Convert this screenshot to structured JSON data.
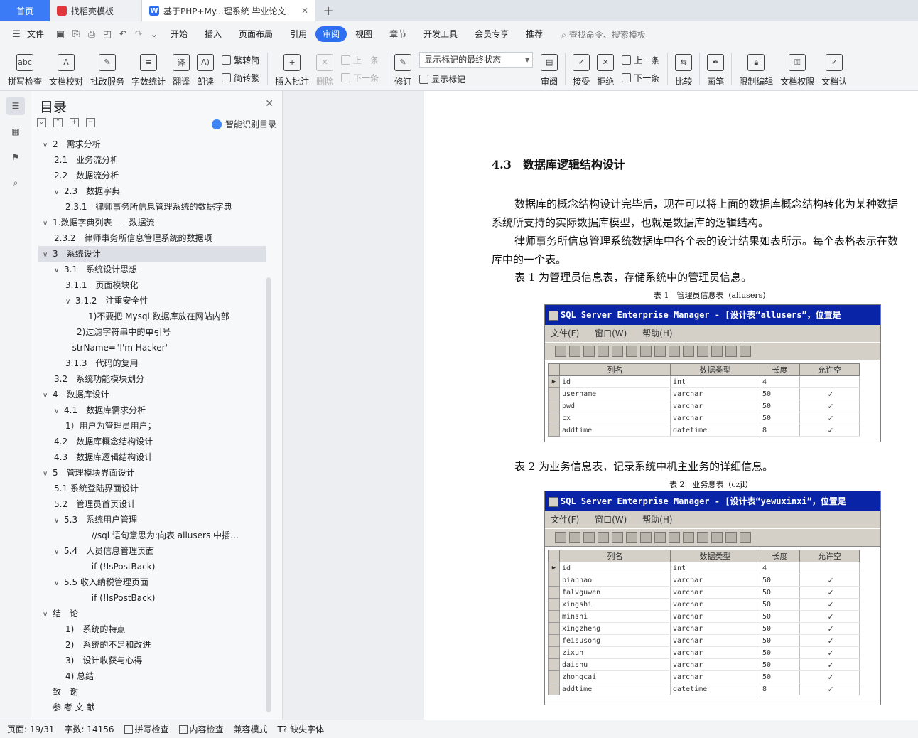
{
  "tabs": [
    {
      "label": "首页"
    },
    {
      "label": "找稻壳模板"
    },
    {
      "label": "基于PHP+My...理系统 毕业论文"
    }
  ],
  "menu": {
    "file": "文件",
    "items": [
      "开始",
      "插入",
      "页面布局",
      "引用",
      "审阅",
      "视图",
      "章节",
      "开发工具",
      "会员专享",
      "推荐"
    ],
    "active": "审阅",
    "search": "查找命令、搜索模板"
  },
  "ribbon": {
    "spell": "拼写检查",
    "proof": "文档校对",
    "batch": "批改服务",
    "count": "字数统计",
    "translate": "翻译",
    "read": "朗读",
    "to_trad": "繁转简",
    "to_simp": "简转繁",
    "insert_comment": "插入批注",
    "delete": "删除",
    "prev": "上一条",
    "next": "下一条",
    "revise": "修订",
    "markup_state": "显示标记的最终状态",
    "show_markup": "显示标记",
    "review": "审阅",
    "accept": "接受",
    "reject": "拒绝",
    "prev2": "上一条",
    "next2": "下一条",
    "compare": "比较",
    "pen": "画笔",
    "restrict": "限制编辑",
    "doc_perm": "文档权限",
    "doc_more": "文档认"
  },
  "toc": {
    "title": "目录",
    "smart": "智能识别目录",
    "items": [
      {
        "text": "2　需求分析",
        "level": 1,
        "caret": "v"
      },
      {
        "text": "2.1　业务流分析",
        "level": 2,
        "caret": ""
      },
      {
        "text": "2.2　数据流分析",
        "level": 2,
        "caret": ""
      },
      {
        "text": "2.3　数据字典",
        "level": 2,
        "caret": "v"
      },
      {
        "text": "2.3.1　律师事务所信息管理系统的数据字典",
        "level": 3,
        "caret": ""
      },
      {
        "text": "1.数据字典列表——数据流",
        "level": 1,
        "caret": "v"
      },
      {
        "text": "2.3.2　律师事务所信息管理系统的数据项",
        "level": 2,
        "caret": ""
      },
      {
        "text": "3　系统设计",
        "level": 1,
        "caret": "v",
        "selected": true
      },
      {
        "text": "3.1　系统设计思想",
        "level": 2,
        "caret": "v"
      },
      {
        "text": "3.1.1　页面模块化",
        "level": 3,
        "caret": ""
      },
      {
        "text": "3.1.2　注重安全性",
        "level": 3,
        "caret": "v"
      },
      {
        "text": "1)不要把 Mysql 数据库放在网站内部",
        "level": 5,
        "caret": ""
      },
      {
        "text": "2)过滤字符串中的单引号",
        "level": 4,
        "caret": ""
      },
      {
        "text": "strName=\"I'm Hacker\"",
        "level": 3.6,
        "caret": ""
      },
      {
        "text": "3.1.3　代码的复用",
        "level": 3,
        "caret": ""
      },
      {
        "text": "3.2　系统功能模块划分",
        "level": 2,
        "caret": ""
      },
      {
        "text": "4　数据库设计",
        "level": 1,
        "caret": "v"
      },
      {
        "text": "4.1　数据库需求分析",
        "level": 2,
        "caret": "v"
      },
      {
        "text": "1）用户为管理员用户；",
        "level": 3,
        "caret": ""
      },
      {
        "text": "4.2　数据库概念结构设计",
        "level": 2,
        "caret": ""
      },
      {
        "text": "4.3　数据库逻辑结构设计",
        "level": 2,
        "caret": ""
      },
      {
        "text": "5　管理模块界面设计",
        "level": 1,
        "caret": "v"
      },
      {
        "text": "5.1  系统登陆界面设计",
        "level": 2,
        "caret": ""
      },
      {
        "text": "5.2　管理员首页设计",
        "level": 2,
        "caret": ""
      },
      {
        "text": "5.3　系统用户管理",
        "level": 2,
        "caret": "v"
      },
      {
        "text": "//sql 语句意思为:向表 allusers 中插…",
        "level": 5.3,
        "caret": ""
      },
      {
        "text": "5.4　人员信息管理页面",
        "level": 2,
        "caret": "v"
      },
      {
        "text": "if (!IsPostBack)",
        "level": 5.3,
        "caret": ""
      },
      {
        "text": "5.5  收入纳税管理页面",
        "level": 2,
        "caret": "v"
      },
      {
        "text": "if (!IsPostBack)",
        "level": 5.3,
        "caret": ""
      },
      {
        "text": "结　论",
        "level": 1,
        "caret": "v"
      },
      {
        "text": "1)　系统的特点",
        "level": 3,
        "caret": ""
      },
      {
        "text": "2)　系统的不足和改进",
        "level": 3,
        "caret": ""
      },
      {
        "text": "3)　设计收获与心得",
        "level": 3,
        "caret": ""
      },
      {
        "text": "4) 总结",
        "level": 3,
        "caret": ""
      },
      {
        "text": "致　谢",
        "level": 1,
        "caret": "none"
      },
      {
        "text": "参 考 文 献",
        "level": 1,
        "caret": "none"
      }
    ]
  },
  "doc": {
    "heading": "4.3　数据库逻辑结构设计",
    "p1a": "数据库的概念结构设计完毕后，现在可以将上面的数据库概念结构转化为某种数据",
    "p1b": "系统所支持的实际数据库模型，也就是数据库的逻辑结构。",
    "p2a": "律师事务所信息管理系统数据库中各个表的设计结果如表所示。每个表格表示在数",
    "p2b": "库中的一个表。",
    "p3": "表 1 为管理员信息表，存储系统中的管理员信息。",
    "cap1": "表 1　管理员信息表（allusers）",
    "p4": "表 2 为业务信息表，记录系统中机主业务的详细信息。",
    "cap2": "表 2　业务息表（czjl）"
  },
  "sql1": {
    "title": "SQL Server Enterprise Manager - [设计表“allusers”，位置是",
    "menu": [
      "文件(F)",
      "窗口(W)",
      "帮助(H)"
    ],
    "headers": [
      "列名",
      "数据类型",
      "长度",
      "允许空"
    ],
    "rows": [
      [
        "id",
        "int",
        "4",
        ""
      ],
      [
        "username",
        "varchar",
        "50",
        "✓"
      ],
      [
        "pwd",
        "varchar",
        "50",
        "✓"
      ],
      [
        "cx",
        "varchar",
        "50",
        "✓"
      ],
      [
        "addtime",
        "datetime",
        "8",
        "✓"
      ]
    ]
  },
  "sql2": {
    "title": "SQL Server Enterprise Manager - [设计表“yewuxinxi”，位置是",
    "menu": [
      "文件(F)",
      "窗口(W)",
      "帮助(H)"
    ],
    "headers": [
      "列名",
      "数据类型",
      "长度",
      "允许空"
    ],
    "rows": [
      [
        "id",
        "int",
        "4",
        ""
      ],
      [
        "bianhao",
        "varchar",
        "50",
        "✓"
      ],
      [
        "falvguwen",
        "varchar",
        "50",
        "✓"
      ],
      [
        "xingshi",
        "varchar",
        "50",
        "✓"
      ],
      [
        "minshi",
        "varchar",
        "50",
        "✓"
      ],
      [
        "xingzheng",
        "varchar",
        "50",
        "✓"
      ],
      [
        "feisusong",
        "varchar",
        "50",
        "✓"
      ],
      [
        "zixun",
        "varchar",
        "50",
        "✓"
      ],
      [
        "daishu",
        "varchar",
        "50",
        "✓"
      ],
      [
        "zhongcai",
        "varchar",
        "50",
        "✓"
      ],
      [
        "addtime",
        "datetime",
        "8",
        "✓"
      ]
    ]
  },
  "status": {
    "page": "页面: 19/31",
    "words": "字数: 14156",
    "spell": "拼写检查",
    "content": "内容检查",
    "compat": "兼容模式",
    "missing_font": "缺失字体"
  },
  "colors": {
    "accent": "#2d6ff0",
    "sql_titlebar": "#0a24a8",
    "sql_face": "#d4d0c8"
  }
}
